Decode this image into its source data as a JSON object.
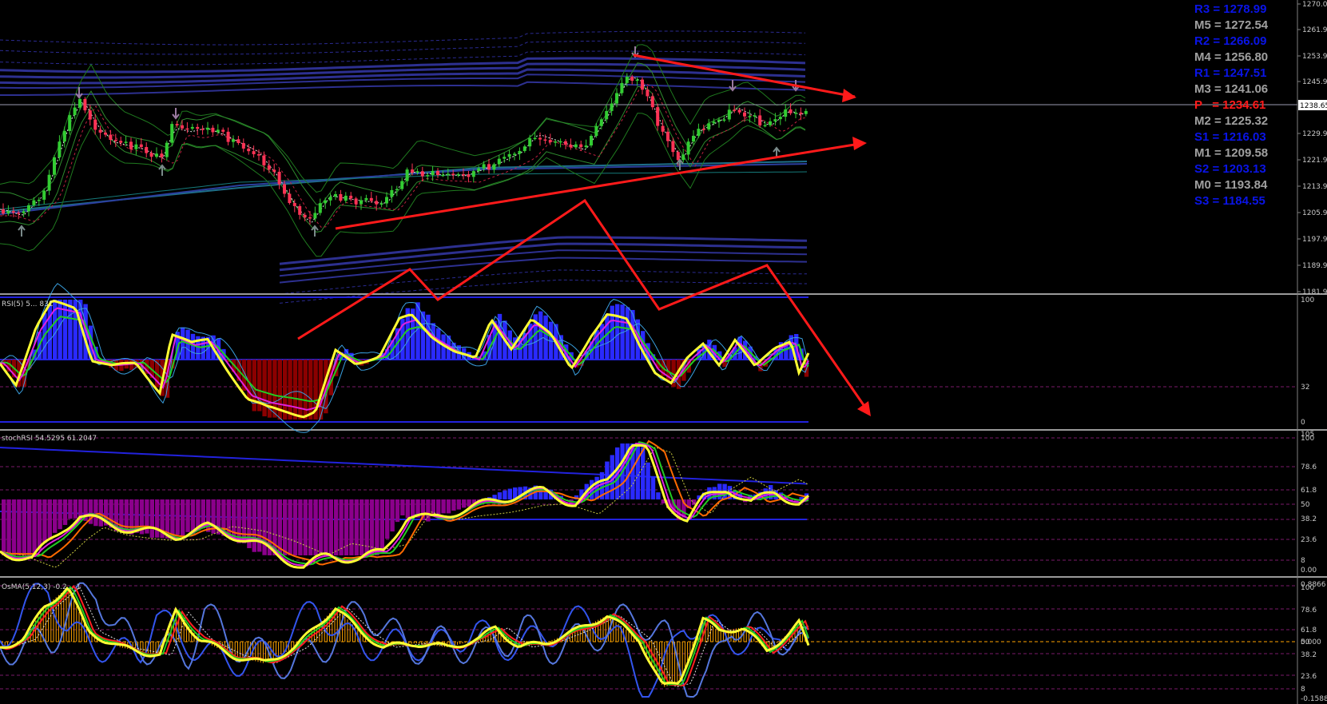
{
  "colors": {
    "background": "#000000",
    "bull_candle": "#33cc33",
    "bear_candle": "#ff3355",
    "annotation": "#ff1a1a",
    "pivot_blue": "#0a14e6",
    "pivot_gray": "#a0a0a0",
    "pivot_red": "#ff1a1a",
    "rsi_histo_up": "#2a2aff",
    "rsi_histo_down": "#8b0000",
    "stoch_histo_down": "#8b008b",
    "osma_histo": "#ffa500"
  },
  "pivots": [
    {
      "text": "R3 = 1278.99",
      "kind": "blue"
    },
    {
      "text": "M5 = 1272.54",
      "kind": "gray"
    },
    {
      "text": "R2 = 1266.09",
      "kind": "blue"
    },
    {
      "text": "M4 = 1256.80",
      "kind": "gray"
    },
    {
      "text": "R1 = 1247.51",
      "kind": "blue"
    },
    {
      "text": "M3 = 1241.06",
      "kind": "gray"
    },
    {
      "text": "P   = 1234.61",
      "kind": "red"
    },
    {
      "text": "M2 = 1225.32",
      "kind": "gray"
    },
    {
      "text": "S1 = 1216.03",
      "kind": "blue"
    },
    {
      "text": "M1 = 1209.58",
      "kind": "gray"
    },
    {
      "text": "S2 = 1203.13",
      "kind": "blue"
    },
    {
      "text": "M0 = 1193.84",
      "kind": "gray"
    },
    {
      "text": "S3 = 1184.55",
      "kind": "blue"
    }
  ],
  "price_axis": {
    "ticks": [
      "1270.00",
      "1261.90",
      "1253.90",
      "1245.90",
      "1237.90",
      "1229.90",
      "1221.90",
      "1213.90",
      "1205.90",
      "1197.90",
      "1189.90",
      "1181.90"
    ],
    "current": "1238.65"
  },
  "rsi_panel": {
    "label": "RSI(5) 5... 831",
    "ticks": [
      "100",
      "32",
      "0"
    ]
  },
  "stoch_panel": {
    "label": "stochRSI 54.5295 61.2047",
    "ticks": [
      "105",
      "100",
      "78.6",
      "61.8",
      "50",
      "38.2",
      "23.6",
      "8",
      "0.00"
    ]
  },
  "osma_panel": {
    "label": "OsMA(5,12,3) -0.2... 1",
    "ticks": [
      "0.8866",
      "100",
      "78.6",
      "61.8",
      "50",
      "0.000",
      "38.2",
      "23.6",
      "8",
      "-0.1588"
    ]
  }
}
